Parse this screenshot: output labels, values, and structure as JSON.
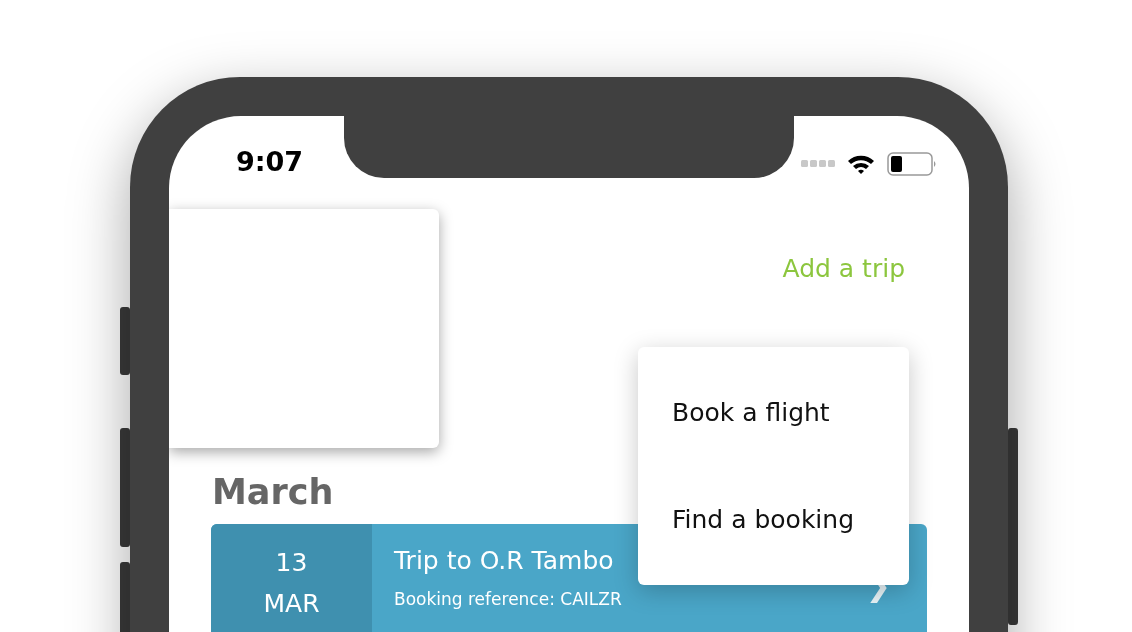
{
  "status_bar": {
    "time": "9:07"
  },
  "header": {
    "add_trip_link": "Add a trip"
  },
  "menu": {
    "items": [
      {
        "label": "Book a flight"
      },
      {
        "label": "Find a booking"
      }
    ]
  },
  "sections": [
    {
      "month": "March",
      "trips": [
        {
          "day": "13",
          "month": "MAR",
          "title": "Trip to O.R Tambo",
          "reference": "Booking reference: CAILZR",
          "chevron": "❯"
        }
      ]
    }
  ]
}
